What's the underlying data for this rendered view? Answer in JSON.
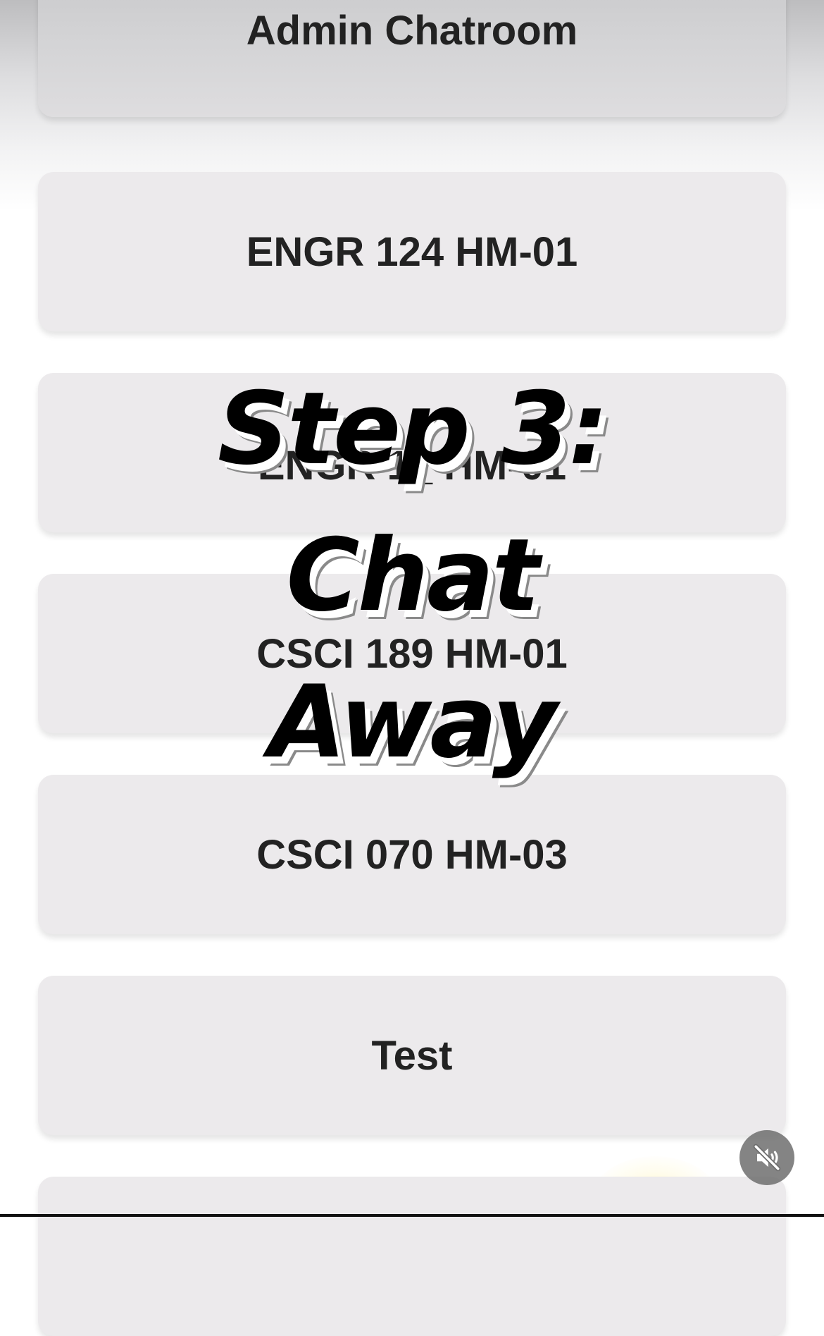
{
  "rooms": [
    {
      "label": "Admin Chatroom"
    },
    {
      "label": "ENGR 124 HM-01"
    },
    {
      "label": "ENGR 1_ HM-01"
    },
    {
      "label": "CSCI 189 HM-01"
    },
    {
      "label": "CSCI 070 HM-03"
    },
    {
      "label": "Test"
    },
    {
      "label": ""
    }
  ],
  "overlay": {
    "line1": "Step 3:",
    "line2": "Chat",
    "line3": "Away"
  },
  "controls": {
    "mute_icon": "speaker-muted-icon"
  },
  "colors": {
    "card_background": "#eceaec",
    "card_text": "#222222",
    "overlay_text": "#000000",
    "overlay_shadow": "#8a8a8a",
    "mute_button": "#6e6e6e"
  }
}
